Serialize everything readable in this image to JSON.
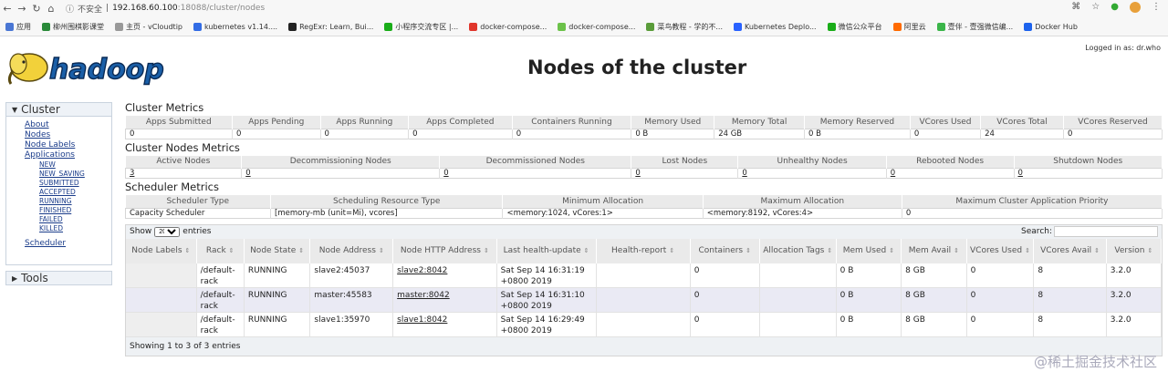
{
  "browser": {
    "security": "不安全",
    "url_host": "192.168.60.100",
    "url_port_path": ":18088/cluster/nodes",
    "bookmarks": [
      {
        "label": "应用",
        "color": "#4a77d4"
      },
      {
        "label": "柳州围棋影课堂",
        "color": "#2a8a3a"
      },
      {
        "label": "主页 - vCloudtip",
        "color": "#999"
      },
      {
        "label": "kubernetes v1.14....",
        "color": "#326ce5"
      },
      {
        "label": "RegExr: Learn, Bui...",
        "color": "#222"
      },
      {
        "label": "小程序交流专区 |...",
        "color": "#1aad19"
      },
      {
        "label": "docker-compose...",
        "color": "#e0352b"
      },
      {
        "label": "docker-compose...",
        "color": "#6cc24a"
      },
      {
        "label": "菜鸟教程 - 学的不...",
        "color": "#5a9c3a"
      },
      {
        "label": "Kubernetes Deplo...",
        "color": "#2962ff"
      },
      {
        "label": "微信公众平台",
        "color": "#1aad19"
      },
      {
        "label": "阿里云",
        "color": "#ff6a00"
      },
      {
        "label": "壹伴 - 壹强微信编...",
        "color": "#3bb54a"
      },
      {
        "label": "Docker Hub",
        "color": "#1d63ed"
      }
    ]
  },
  "header": {
    "logo_text": "hadoop",
    "title": "Nodes of the cluster",
    "login": "Logged in as: dr.who"
  },
  "sidebar": {
    "cluster_label": "Cluster",
    "links": [
      "About",
      "Nodes",
      "Node Labels",
      "Applications"
    ],
    "app_states": [
      "NEW",
      "NEW_SAVING",
      "SUBMITTED",
      "ACCEPTED",
      "RUNNING",
      "FINISHED",
      "FAILED",
      "KILLED"
    ],
    "scheduler": "Scheduler",
    "tools_label": "Tools"
  },
  "cluster_metrics": {
    "title": "Cluster Metrics",
    "headers": [
      "Apps Submitted",
      "Apps Pending",
      "Apps Running",
      "Apps Completed",
      "Containers Running",
      "Memory Used",
      "Memory Total",
      "Memory Reserved",
      "VCores Used",
      "VCores Total",
      "VCores Reserved"
    ],
    "values": [
      "0",
      "0",
      "0",
      "0",
      "0",
      "0 B",
      "24 GB",
      "0 B",
      "0",
      "24",
      "0"
    ]
  },
  "node_metrics": {
    "title": "Cluster Nodes Metrics",
    "headers": [
      "Active Nodes",
      "Decommissioning Nodes",
      "Decommissioned Nodes",
      "Lost Nodes",
      "Unhealthy Nodes",
      "Rebooted Nodes",
      "Shutdown Nodes"
    ],
    "values": [
      "3",
      "0",
      "0",
      "0",
      "0",
      "0",
      "0"
    ]
  },
  "scheduler_metrics": {
    "title": "Scheduler Metrics",
    "headers": [
      "Scheduler Type",
      "Scheduling Resource Type",
      "Minimum Allocation",
      "Maximum Allocation",
      "Maximum Cluster Application Priority"
    ],
    "values": [
      "Capacity Scheduler",
      "[memory-mb (unit=Mi), vcores]",
      "<memory:1024, vCores:1>",
      "<memory:8192, vCores:4>",
      "0"
    ]
  },
  "nodes_table": {
    "show_label": "Show",
    "show_value": "20",
    "entries_label": "entries",
    "search_label": "Search:",
    "headers": [
      "Node Labels",
      "Rack",
      "Node State",
      "Node Address",
      "Node HTTP Address",
      "Last health-update",
      "Health-report",
      "Containers",
      "Allocation Tags",
      "Mem Used",
      "Mem Avail",
      "VCores Used",
      "VCores Avail",
      "Version"
    ],
    "rows": [
      [
        "",
        "/default-rack",
        "RUNNING",
        "slave2:45037",
        "slave2:8042",
        "Sat Sep 14 16:31:19 +0800 2019",
        "",
        "0",
        "",
        "0 B",
        "8 GB",
        "0",
        "8",
        "3.2.0"
      ],
      [
        "",
        "/default-rack",
        "RUNNING",
        "master:45583",
        "master:8042",
        "Sat Sep 14 16:31:10 +0800 2019",
        "",
        "0",
        "",
        "0 B",
        "8 GB",
        "0",
        "8",
        "3.2.0"
      ],
      [
        "",
        "/default-rack",
        "RUNNING",
        "slave1:35970",
        "slave1:8042",
        "Sat Sep 14 16:29:49 +0800 2019",
        "",
        "0",
        "",
        "0 B",
        "8 GB",
        "0",
        "8",
        "3.2.0"
      ]
    ],
    "footer": "Showing 1 to 3 of 3 entries"
  },
  "watermark": "@稀土掘金技术社区"
}
